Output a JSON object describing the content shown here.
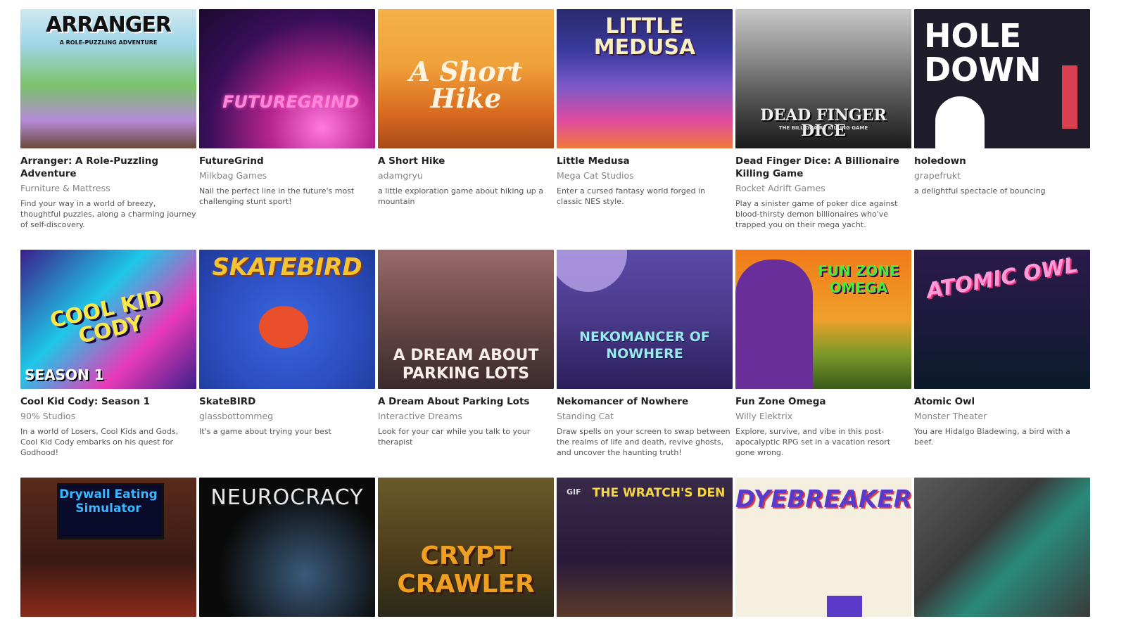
{
  "games": [
    {
      "title": "Arranger: A Role-Puzzling Adventure",
      "author": "Furniture & Mattress",
      "desc": "Find your way in a world of breezy, thoughtful puzzles, along a charming journey of self-discovery.",
      "art_text": "ARRANGER",
      "art_sub": "A ROLE-PUZZLING ADVENTURE",
      "colors": [
        "#9fd6e8",
        "#7ac36a"
      ]
    },
    {
      "title": "FutureGrind",
      "author": "Milkbag Games",
      "desc": "Nail the perfect line in the future's most challenging stunt sport!",
      "art_text": "FUTUREGRIND",
      "colors": [
        "#1b0a2e",
        "#b8248e"
      ]
    },
    {
      "title": "A Short Hike",
      "author": "adamgryu",
      "desc": "a little exploration game about hiking up a mountain",
      "art_text": "A Short Hike",
      "colors": [
        "#f0a13a",
        "#d96a1f"
      ]
    },
    {
      "title": "Little Medusa",
      "author": "Mega Cat Studios",
      "desc": "Enter a cursed fantasy world forged in classic NES style.",
      "art_text": "LITTLE MEDUSA",
      "colors": [
        "#3a3a9e",
        "#e04aa0"
      ]
    },
    {
      "title": "Dead Finger Dice: A Billionaire Killing Game",
      "author": "Rocket Adrift Games",
      "desc": "Play a sinister game of poker dice against blood-thirsty demon billionaires who've trapped you on their mega yacht.",
      "art_text": "DEAD FINGER DICE",
      "art_sub": "THE BILLIONAIRE KILLING GAME",
      "colors": [
        "#e8e8e8",
        "#3a3a3a"
      ]
    },
    {
      "title": "holedown",
      "author": "grapefrukt",
      "desc": "a delightful spectacle of bouncing",
      "art_text": "HOLE DOWN",
      "colors": [
        "#1f1c2b",
        "#d84050"
      ]
    },
    {
      "title": "Cool Kid Cody: Season 1",
      "author": "90% Studios",
      "desc": "In a world of Losers, Cool Kids and Gods, Cool Kid Cody embarks on his quest for Godhood!",
      "art_text": "COOL KID CODY",
      "art_sub": "SEASON 1",
      "colors": [
        "#3b1f8a",
        "#1ec7e8"
      ]
    },
    {
      "title": "SkateBIRD",
      "author": "glassbottommeg",
      "desc": "It's a game about trying your best",
      "art_text": "SKATEBIRD",
      "colors": [
        "#2c4fc2",
        "#e94f2a"
      ]
    },
    {
      "title": "A Dream About Parking Lots",
      "author": "Interactive Dreams",
      "desc": "Look for your car while you talk to your therapist",
      "art_text": "A DREAM ABOUT PARKING LOTS",
      "colors": [
        "#6e4c48",
        "#3a2a2e"
      ]
    },
    {
      "title": "Nekomancer of Nowhere",
      "author": "Standing Cat",
      "desc": "Draw spells on your screen to swap between the realms of life and death, revive ghosts, and uncover the haunting truth!",
      "art_text": "NEKOMANCER OF NOWHERE",
      "colors": [
        "#4a3a8a",
        "#b9a4e8"
      ]
    },
    {
      "title": "Fun Zone Omega",
      "author": "Willy Elektrix",
      "desc": "Explore, survive, and vibe in this post-apocalyptic RPG set in a vacation resort gone wrong.",
      "art_text": "FUN ZONE OMEGA",
      "colors": [
        "#f07a1a",
        "#6a2e9a"
      ]
    },
    {
      "title": "Atomic Owl",
      "author": "Monster Theater",
      "desc": "You are Hidalgo Bladewing, a bird with a beef.",
      "art_text": "ATOMIC OWL",
      "colors": [
        "#1a1a3a",
        "#e8307a"
      ]
    },
    {
      "title": "",
      "author": "",
      "desc": "",
      "art_text": "Drywall Eating Simulator",
      "colors": [
        "#3a1a14",
        "#1a3acc"
      ]
    },
    {
      "title": "",
      "author": "",
      "desc": "",
      "art_text": "NEUROCRACY",
      "colors": [
        "#0a0a0a",
        "#6aa8d8"
      ]
    },
    {
      "title": "",
      "author": "",
      "desc": "",
      "art_text": "CRYPT CRAWLER",
      "colors": [
        "#4a3a1a",
        "#f0a020"
      ]
    },
    {
      "title": "",
      "author": "",
      "desc": "",
      "art_text": "THE WRATCH'S DEN",
      "gif": "GIF",
      "colors": [
        "#2a1a3a",
        "#c86a2a"
      ]
    },
    {
      "title": "",
      "author": "",
      "desc": "",
      "art_text": "DYEBREAKER",
      "colors": [
        "#f5efe0",
        "#5a3ac8"
      ]
    },
    {
      "title": "",
      "author": "",
      "desc": "",
      "art_text": "",
      "colors": [
        "#3a3a3a",
        "#2a8a7a"
      ]
    }
  ]
}
